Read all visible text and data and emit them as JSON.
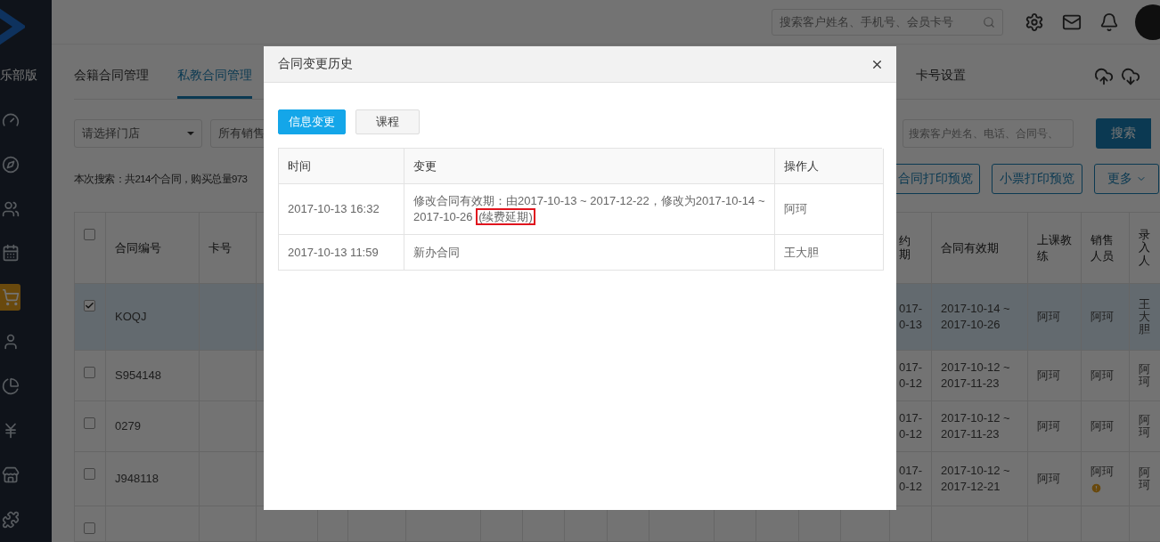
{
  "sidebar": {
    "brand": "乐部版",
    "items": [
      {
        "selected": false
      },
      {
        "selected": false
      },
      {
        "selected": false
      },
      {
        "selected": false
      },
      {
        "selected": true
      },
      {
        "selected": false
      },
      {
        "selected": false
      },
      {
        "selected": false
      },
      {
        "selected": false
      },
      {
        "selected": false
      }
    ]
  },
  "header": {
    "search": {
      "placeholder": "搜索客户姓名、手机号、会员卡号"
    }
  },
  "tabs": [
    {
      "label": "会籍合同管理",
      "selected": false
    },
    {
      "label": "私教合同管理",
      "selected": true
    },
    {
      "label": "卡号设置",
      "selected": false
    }
  ],
  "filters": {
    "store_select": "请选择门店",
    "sales_select": "所有销售",
    "search": {
      "placeholder": "搜索客户姓名、电话、合同号、"
    },
    "search_button": "搜索"
  },
  "summary": "本次搜索：共214个合同，购买总量973",
  "actions": [
    {
      "label": "合同打印预览",
      "kind": "button"
    },
    {
      "label": "小票打印预览",
      "kind": "button"
    },
    {
      "label": "更多",
      "kind": "dropdown"
    }
  ],
  "table": {
    "all_checked": false,
    "columns": [
      "合同编号",
      "卡号",
      "约期",
      "合同有效期",
      "上课教练",
      "销售人员",
      "录入人"
    ],
    "rows": [
      {
        "selected": true,
        "contract_no": "KOQJ",
        "signed_date": [
          "017-",
          "0-13"
        ],
        "validity": "2017-10-14 ~ 2017-10-26",
        "coach": "阿珂",
        "sales": "阿珂",
        "warning": false,
        "entered_by": "王大胆"
      },
      {
        "selected": false,
        "contract_no": "S954148",
        "signed_date": [
          "017-",
          "0-12"
        ],
        "validity": "2017-10-12 ~ 2017-11-23",
        "coach": "阿珂",
        "sales": "阿珂",
        "warning": false,
        "entered_by": "阿珂"
      },
      {
        "selected": false,
        "contract_no": "0279",
        "signed_date": [
          "017-",
          "0-12"
        ],
        "validity": "2017-10-12 ~ 2017-11-23",
        "coach": "阿珂",
        "sales": "阿珂",
        "warning": false,
        "entered_by": "阿珂"
      },
      {
        "selected": false,
        "contract_no": "J948118",
        "signed_date": [
          "017-",
          "0-12"
        ],
        "validity": "2017-10-12 ~ 2017-12-21",
        "coach": "阿珂",
        "sales": "阿珂",
        "warning": true,
        "entered_by": "阿珂"
      },
      {
        "selected": false
      }
    ]
  },
  "dialog": {
    "title": "合同变更历史",
    "tabs": [
      {
        "label": "信息变更",
        "selected": true
      },
      {
        "label": "课程",
        "selected": false
      }
    ],
    "columns": [
      "时间",
      "变更",
      "操作人"
    ],
    "rows": [
      {
        "time": "2017-10-13 16:32",
        "change": "修改合同有效期：由2017-10-13 ~ 2017-12-22，修改为2017-10-14 ~ 2017-10-26",
        "note": "(续费延期)",
        "operator": "阿珂"
      },
      {
        "time": "2017-10-13 11:59",
        "change": "新办合同",
        "operator": "王大胆"
      }
    ]
  }
}
